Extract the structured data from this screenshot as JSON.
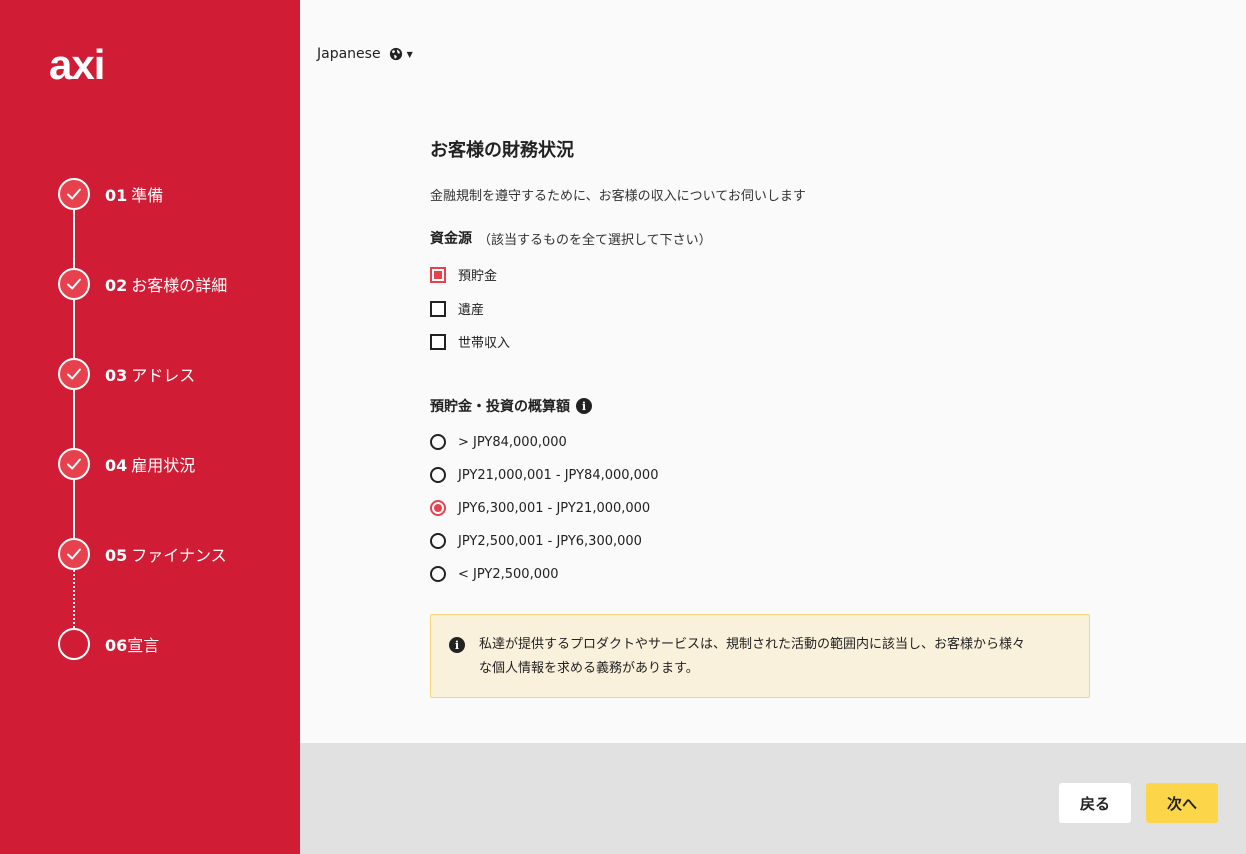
{
  "brand": {
    "logo_text": "axi",
    "accent_color": "#d01d35",
    "check_color": "#e8414e",
    "next_button_color": "#fdd549"
  },
  "language": {
    "label": "Japanese",
    "icon": "globe-icon"
  },
  "steps": [
    {
      "num": "01",
      "label": "準備",
      "status": "done"
    },
    {
      "num": "02",
      "label": "お客様の詳細",
      "status": "done"
    },
    {
      "num": "03",
      "label": "アドレス",
      "status": "done"
    },
    {
      "num": "04",
      "label": "雇用状況",
      "status": "done"
    },
    {
      "num": "05",
      "label": "ファイナンス",
      "status": "done"
    },
    {
      "num": "06",
      "label": "宣言",
      "status": "pending"
    }
  ],
  "main": {
    "title": "お客様の財務状況",
    "subtitle": "金融規制を遵守するために、お客様の収入についてお伺いします",
    "funds_source": {
      "heading": "資金源",
      "note": "（該当するものを全て選択して下さい）",
      "options": [
        {
          "label": "預貯金",
          "checked": true
        },
        {
          "label": "遺産",
          "checked": false
        },
        {
          "label": "世帯収入",
          "checked": false
        }
      ]
    },
    "savings": {
      "heading": "預貯金・投資の概算額",
      "options": [
        {
          "label": "> JPY84,000,000",
          "checked": false
        },
        {
          "label": "JPY21,000,001 - JPY84,000,000",
          "checked": false
        },
        {
          "label": "JPY6,300,001 - JPY21,000,000",
          "checked": true
        },
        {
          "label": "JPY2,500,001 - JPY6,300,000",
          "checked": false
        },
        {
          "label": "< JPY2,500,000",
          "checked": false
        }
      ]
    },
    "notice": {
      "line1": "私達が提供するプロダクトやサービスは、規制された活動の範囲内に該当し、お客様から様々",
      "line2": "な個人情報を求める義務があります。"
    }
  },
  "footer": {
    "back_label": "戻る",
    "next_label": "次へ"
  }
}
